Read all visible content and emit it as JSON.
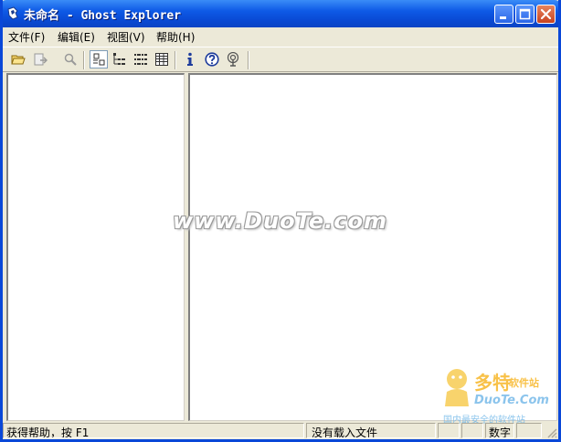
{
  "window": {
    "title": "未命名 - Ghost Explorer"
  },
  "menu": {
    "items": [
      {
        "label": "文件(F)"
      },
      {
        "label": "编辑(E)"
      },
      {
        "label": "视图(V)"
      },
      {
        "label": "帮助(H)"
      }
    ]
  },
  "toolbar": {
    "tools": [
      "open-folder-icon",
      "extract-icon",
      "find-icon",
      "view-large-icon",
      "view-small-icon",
      "view-list-icon",
      "view-details-icon",
      "info-icon",
      "help-icon",
      "web-icon"
    ],
    "pressed": "view-large-icon"
  },
  "watermark": {
    "text": "www.DuoTe.com"
  },
  "logo": {
    "brand": "多特",
    "tagline": "软件站",
    "domain": "DuoTe.Com",
    "slogan": "国内最安全的软件站"
  },
  "status": {
    "help_text": "获得帮助，按 F1",
    "file_status": "没有载入文件",
    "num_indicator": "数字"
  },
  "colors": {
    "titlebar": "#0A4BD6",
    "window_bg": "#ECE9D8",
    "close_button": "#C84320"
  }
}
